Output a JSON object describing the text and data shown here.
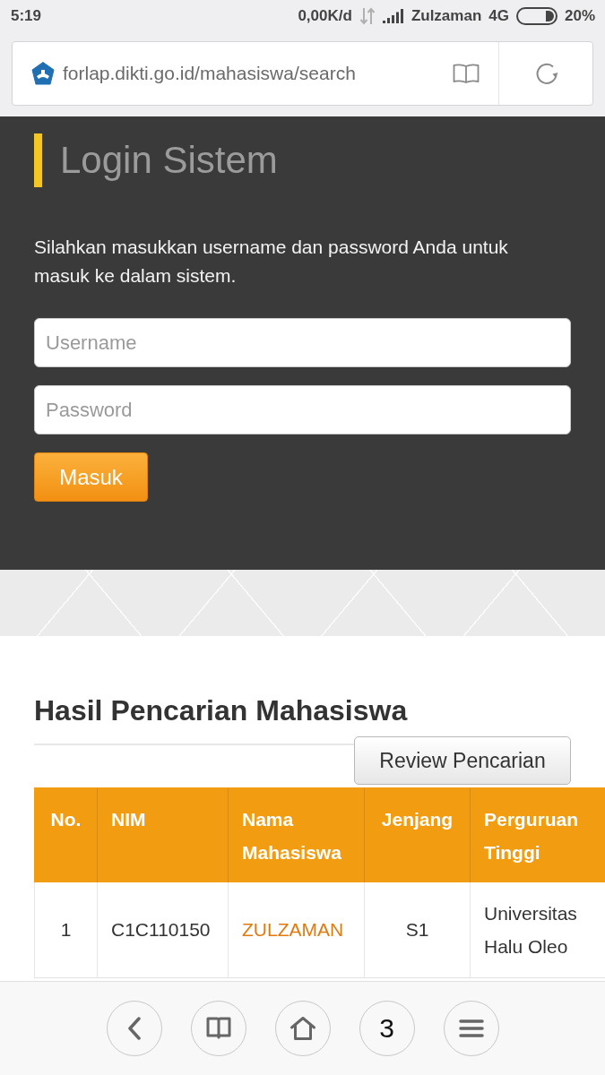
{
  "status_bar": {
    "time": "5:19",
    "network_speed": "0,00K/d",
    "carrier": "Zulzaman",
    "network_type": "4G",
    "battery_percent": "20%"
  },
  "address_bar": {
    "url": "forlap.dikti.go.id/mahasiswa/search"
  },
  "login": {
    "title": "Login Sistem",
    "instructions": "Silahkan masukkan username dan password Anda untuk masuk ke dalam sistem.",
    "username": {
      "placeholder": "Username"
    },
    "password": {
      "placeholder": "Password"
    },
    "submit_button": "Masuk"
  },
  "results": {
    "title": "Hasil Pencarian Mahasiswa",
    "review_button": "Review Pencarian",
    "table": {
      "columns": [
        "No.",
        "NIM",
        "Nama Mahasiswa",
        "Jenjang",
        "Perguruan Tinggi"
      ],
      "rows": [
        {
          "no": "1",
          "nim": "C1C110150",
          "nama_mahasiswa": "ZULZAMAN",
          "jenjang": "S1",
          "perguruan_tinggi": "Universitas Halu Oleo"
        }
      ]
    }
  },
  "bottom_nav": [
    {
      "kind": "back"
    },
    {
      "kind": "bookmarks"
    },
    {
      "kind": "home"
    },
    {
      "kind": "tabs",
      "label": "3"
    },
    {
      "kind": "menu"
    }
  ]
}
